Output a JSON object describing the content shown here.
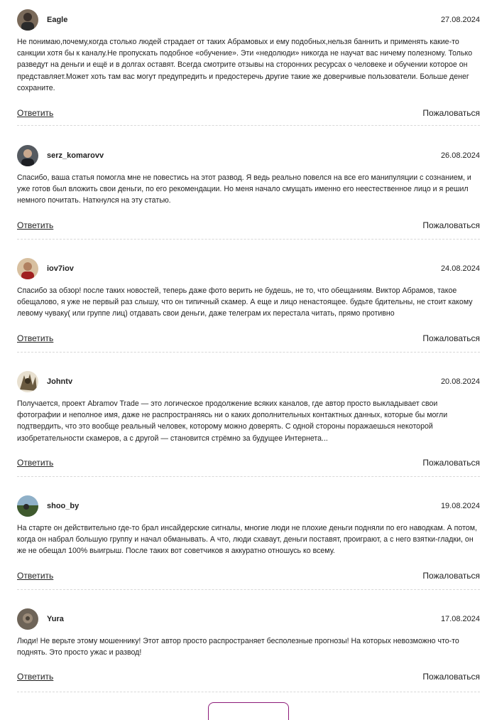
{
  "comments": [
    {
      "author": "Eagle",
      "date": "27.08.2024",
      "text": "Не понимаю,почему,когда столько людей страдает от таких Абрамовых и ему подобных,нельзя баннить и применять какие-то санкции хотя бы к каналу.Не пропускать подобное «обучение». Эти «недолюди» никогда не научат вас ничему полезному. Только разведут на деньги и ещё и в долгах оставят. Всегда смотрите отзывы на сторонних ресурсах о человеке и обучении которое он представляет.Может хоть там вас могут предупредить и предостеречь другие такие же доверчивые пользователи. Больше денег сохраните.",
      "reply": "Ответить",
      "report": "Пожаловаться"
    },
    {
      "author": "serz_komarovv",
      "date": "26.08.2024",
      "text": "Спасибо, ваша статья помогла мне не повестись на этот развод. Я ведь реально повелся на все его манипуляции с сознанием, и уже готов был вложить свои деньги, по его рекомендации. Но меня начало смущать именно его неестественное лицо и я решил немного почитать. Наткнулся на эту статью.",
      "reply": "Ответить",
      "report": "Пожаловаться"
    },
    {
      "author": "iov7iov",
      "date": "24.08.2024",
      "text": "Спасибо за обзор! после таких новостей, теперь даже фото верить не будешь, не то, что обещаниям. Виктор Абрамов, такое обещалово, я уже не первый раз слышу, что он типичный скамер. А еще и лицо ненастоящее. будьте бдительны, не стоит какому левому чуваку( или группе лиц) отдавать свои деньги, даже телеграм их перестала читать, прямо противно",
      "reply": "Ответить",
      "report": "Пожаловаться"
    },
    {
      "author": "Johntv",
      "date": "20.08.2024",
      "text": "Получается, проект Abramov Trade — это логическое продолжение всяких каналов, где автор просто выкладывает свои фотографии и неполное имя, даже не распространяясь ни о каких дополнительных контактных данных, которые бы могли подтвердить, что это вообще реальный человек, которому можно доверять. С одной стороны поражаешься некоторой изобретательности скамеров, а с другой — становится стрёмно за будущее Интернета...",
      "reply": "Ответить",
      "report": "Пожаловаться"
    },
    {
      "author": "shoo_by",
      "date": "19.08.2024",
      "text": "На старте он действительно где-то брал инсайдерские сигналы, многие люди не плохие деньги подняли по его наводкам. А потом, когда он набрал большую группу и начал обманывать. А что, люди схаваут, деньги поставят, проиграют, а с него взятки-гладки, он же не обещал 100% выигрыш. После таких вот советчиков я аккуратно отношусь ко всему.",
      "reply": "Ответить",
      "report": "Пожаловаться"
    },
    {
      "author": "Yura",
      "date": "17.08.2024",
      "text": "Люди! Не верьте этому мошеннику! Этот автор просто распространяет бесполезные прогнозы! На которых невозможно что-то поднять. Это просто ужас и развод!",
      "reply": "Ответить",
      "report": "Пожаловаться"
    }
  ],
  "colors": {
    "text": "#222222",
    "divider": "#d8d8d8",
    "accent": "#8c1a78"
  }
}
